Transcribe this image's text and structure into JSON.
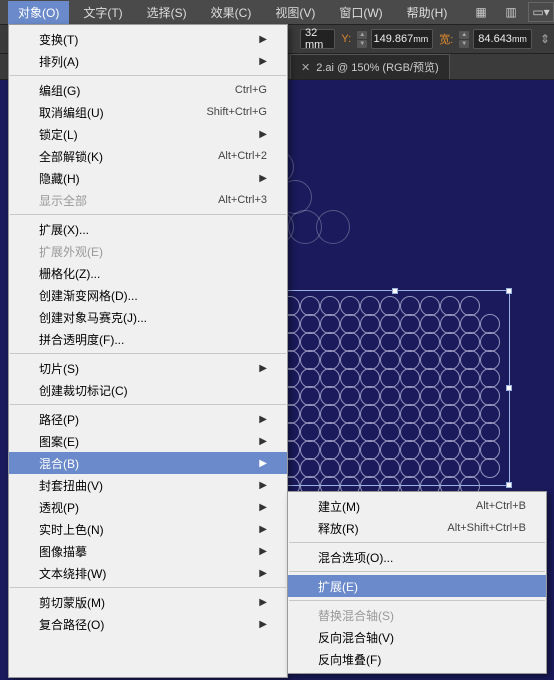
{
  "menubar": {
    "items": [
      {
        "label": "对象(O)"
      },
      {
        "label": "文字(T)"
      },
      {
        "label": "选择(S)"
      },
      {
        "label": "效果(C)"
      },
      {
        "label": "视图(V)"
      },
      {
        "label": "窗口(W)"
      },
      {
        "label": "帮助(H)"
      }
    ]
  },
  "controls": {
    "field0_value": "32 mm",
    "field0_label": "Y:",
    "field1_value": "149.867",
    "field1_label": "宽:",
    "field2_value": "84.643",
    "unit_suffix": "mm"
  },
  "tab": {
    "x_icon": "✕",
    "title": "2.ai @ 150% (RGB/预览)"
  },
  "menu": {
    "g1": [
      {
        "label": "变换(T)",
        "sub": true
      },
      {
        "label": "排列(A)",
        "sub": true
      }
    ],
    "g2": [
      {
        "label": "编组(G)",
        "shortcut": "Ctrl+G"
      },
      {
        "label": "取消编组(U)",
        "shortcut": "Shift+Ctrl+G"
      },
      {
        "label": "锁定(L)",
        "sub": true
      },
      {
        "label": "全部解锁(K)",
        "shortcut": "Alt+Ctrl+2"
      },
      {
        "label": "隐藏(H)",
        "sub": true
      },
      {
        "label": "显示全部",
        "shortcut": "Alt+Ctrl+3",
        "disabled": true
      }
    ],
    "g3": [
      {
        "label": "扩展(X)..."
      },
      {
        "label": "扩展外观(E)",
        "disabled": true
      },
      {
        "label": "栅格化(Z)..."
      },
      {
        "label": "创建渐变网格(D)..."
      },
      {
        "label": "创建对象马赛克(J)..."
      },
      {
        "label": "拼合透明度(F)..."
      }
    ],
    "g4": [
      {
        "label": "切片(S)",
        "sub": true
      },
      {
        "label": "创建裁切标记(C)"
      }
    ],
    "g5": [
      {
        "label": "路径(P)",
        "sub": true
      },
      {
        "label": "图案(E)",
        "sub": true
      },
      {
        "label": "混合(B)",
        "sub": true,
        "hl": true
      },
      {
        "label": "封套扭曲(V)",
        "sub": true
      },
      {
        "label": "透视(P)",
        "sub": true
      },
      {
        "label": "实时上色(N)",
        "sub": true
      },
      {
        "label": "图像描摹",
        "sub": true
      },
      {
        "label": "文本绕排(W)",
        "sub": true
      }
    ],
    "g6": [
      {
        "label": "剪切蒙版(M)",
        "sub": true
      },
      {
        "label": "复合路径(O)",
        "sub": true
      }
    ]
  },
  "submenu": {
    "g1": [
      {
        "label": "建立(M)",
        "shortcut": "Alt+Ctrl+B"
      },
      {
        "label": "释放(R)",
        "shortcut": "Alt+Shift+Ctrl+B"
      }
    ],
    "g2": [
      {
        "label": "混合选项(O)..."
      }
    ],
    "g3": [
      {
        "label": "扩展(E)",
        "hl": true
      }
    ],
    "g4": [
      {
        "label": "替换混合轴(S)",
        "disabled": true
      },
      {
        "label": "反向混合轴(V)"
      },
      {
        "label": "反向堆叠(F)"
      }
    ]
  },
  "icons": {
    "grid": "▦",
    "panel": "▥",
    "dropdown": "▾",
    "chain": "⇕"
  }
}
